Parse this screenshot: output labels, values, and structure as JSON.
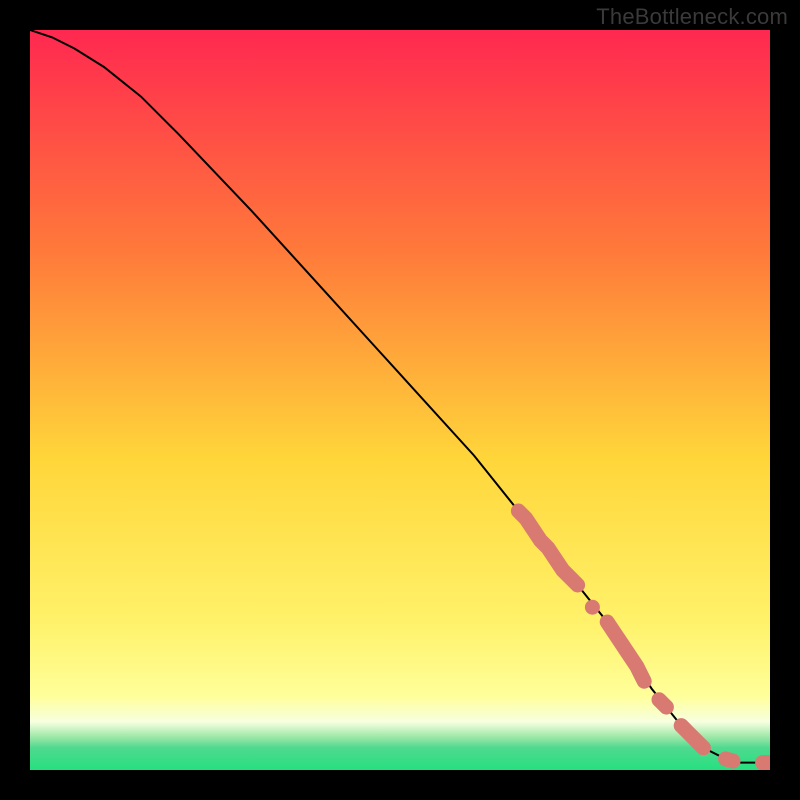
{
  "attribution": "TheBottleneck.com",
  "colors": {
    "background": "#000000",
    "gradient_top": "#ff2850",
    "gradient_mid_upper": "#ff7a3a",
    "gradient_mid": "#ffd63a",
    "gradient_mid_lower": "#fff26a",
    "gradient_band": "#f7ffe0",
    "gradient_bottom": "#26e07f",
    "curve": "#000000",
    "marker": "#d97a72"
  },
  "chart_data": {
    "type": "line",
    "title": "",
    "xlabel": "",
    "ylabel": "",
    "xlim": [
      0,
      100
    ],
    "ylim": [
      0,
      100
    ],
    "series": [
      {
        "name": "bottleneck-curve",
        "x": [
          0,
          3,
          6,
          10,
          15,
          20,
          30,
          40,
          50,
          60,
          66,
          70,
          74,
          78,
          80,
          82,
          84,
          86,
          88,
          90,
          92,
          94,
          96,
          98,
          100
        ],
        "y": [
          100,
          99,
          97.5,
          95,
          91,
          86,
          75.5,
          64.5,
          53.5,
          42.5,
          35,
          30,
          25,
          20,
          17,
          14,
          11,
          8.5,
          6,
          4,
          2.5,
          1.5,
          1,
          1,
          1
        ]
      }
    ],
    "markers": {
      "name": "highlighted-points",
      "x": [
        66,
        67,
        68,
        69,
        70,
        71,
        72,
        73,
        74,
        76,
        78,
        79,
        80,
        81,
        82,
        83,
        85,
        86,
        88,
        89,
        90,
        91,
        94,
        95,
        99,
        100
      ],
      "y": [
        35,
        34,
        32.5,
        31,
        30,
        28.5,
        27,
        26,
        25,
        22,
        20,
        18.5,
        17,
        15.5,
        14,
        12,
        9.5,
        8.5,
        6,
        5,
        4,
        3,
        1.5,
        1.2,
        1,
        1
      ]
    }
  }
}
